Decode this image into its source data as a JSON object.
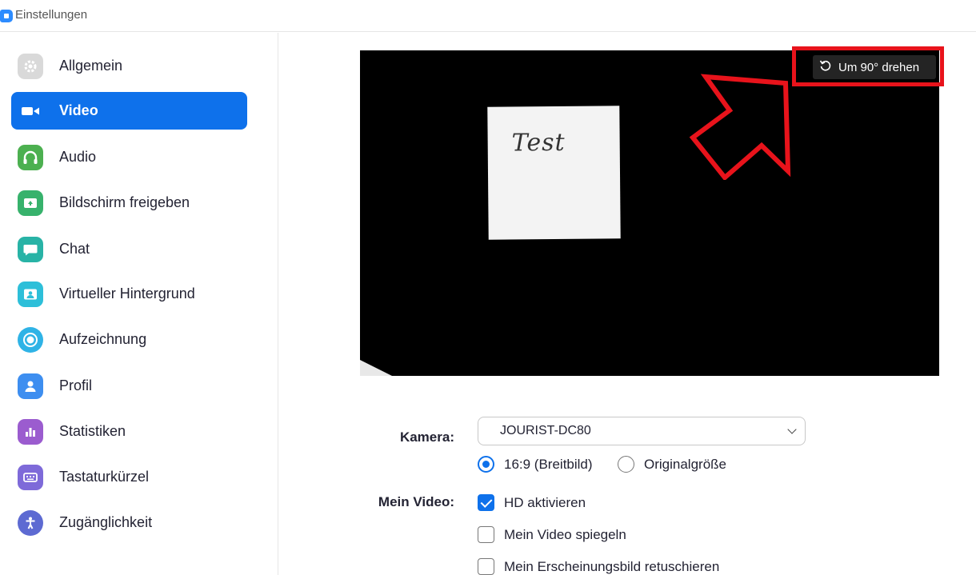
{
  "window": {
    "title": "Einstellungen"
  },
  "sidebar": {
    "items": [
      {
        "label": "Allgemein",
        "icon": "gear-icon",
        "color": "#d9d9d9"
      },
      {
        "label": "Video",
        "icon": "video-camera-icon",
        "color": "#0e71eb",
        "active": true
      },
      {
        "label": "Audio",
        "icon": "headphones-icon",
        "color": "#4cb050"
      },
      {
        "label": "Bildschirm freigeben",
        "icon": "share-screen-icon",
        "color": "#37b26c"
      },
      {
        "label": "Chat",
        "icon": "chat-bubble-icon",
        "color": "#28b3a6"
      },
      {
        "label": "Virtueller Hintergrund",
        "icon": "virtual-background-icon",
        "color": "#2dbfd9"
      },
      {
        "label": "Aufzeichnung",
        "icon": "record-icon",
        "color": "#2fb3e6"
      },
      {
        "label": "Profil",
        "icon": "profile-icon",
        "color": "#3d8ef0"
      },
      {
        "label": "Statistiken",
        "icon": "statistics-icon",
        "color": "#9b5ccf"
      },
      {
        "label": "Tastaturkürzel",
        "icon": "keyboard-icon",
        "color": "#7e6ad9"
      },
      {
        "label": "Zugänglichkeit",
        "icon": "accessibility-icon",
        "color": "#5d6ad2"
      }
    ]
  },
  "preview": {
    "note_text": "Test",
    "rotate_button": {
      "label": "Um 90° drehen",
      "icon": "rotate-icon"
    },
    "annotation_color": "#e8131b"
  },
  "settings": {
    "camera": {
      "label": "Kamera:",
      "value": "JOURIST-DC80"
    },
    "aspect": {
      "options": [
        {
          "label": "16:9 (Breitbild)",
          "checked": true
        },
        {
          "label": "Originalgröße",
          "checked": false
        }
      ]
    },
    "my_video": {
      "label": "Mein Video:",
      "options": [
        {
          "label": "HD aktivieren",
          "checked": true
        },
        {
          "label": "Mein Video spiegeln",
          "checked": false
        },
        {
          "label": "Mein Erscheinungsbild retuschieren",
          "checked": false
        }
      ]
    }
  }
}
